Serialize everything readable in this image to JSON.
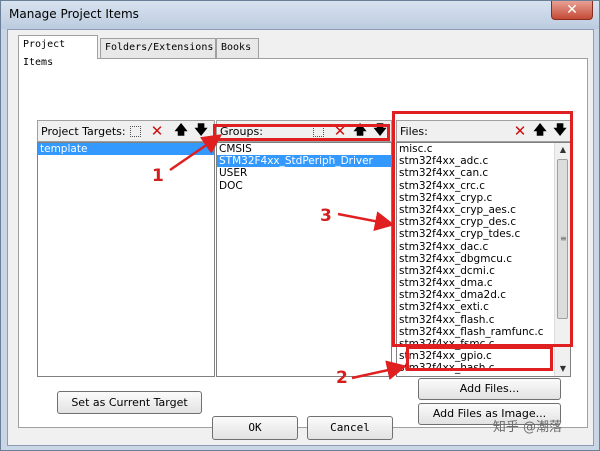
{
  "window": {
    "title": "Manage Project Items",
    "close_glyph": "✕"
  },
  "tabs": [
    {
      "label": "Project Items",
      "active": true
    },
    {
      "label": "Folders/Extensions",
      "active": false
    },
    {
      "label": "Books",
      "active": false
    }
  ],
  "project_targets": {
    "label": "Project Targets:",
    "items": [
      "template"
    ],
    "selected": "template"
  },
  "groups": {
    "label": "Groups:",
    "items": [
      "CMSIS",
      "STM32F4xx_StdPeriph_Driver",
      "USER",
      "DOC"
    ],
    "selected": "STM32F4xx_StdPeriph_Driver"
  },
  "files": {
    "label": "Files:",
    "items": [
      "misc.c",
      "stm32f4xx_adc.c",
      "stm32f4xx_can.c",
      "stm32f4xx_crc.c",
      "stm32f4xx_cryp.c",
      "stm32f4xx_cryp_aes.c",
      "stm32f4xx_cryp_des.c",
      "stm32f4xx_cryp_tdes.c",
      "stm32f4xx_dac.c",
      "stm32f4xx_dbgmcu.c",
      "stm32f4xx_dcmi.c",
      "stm32f4xx_dma.c",
      "stm32f4xx_dma2d.c",
      "stm32f4xx_exti.c",
      "stm32f4xx_flash.c",
      "stm32f4xx_flash_ramfunc.c",
      "stm32f4xx_fsmc.c",
      "stm32f4xx_gpio.c",
      "stm32f4xx_hash.c"
    ]
  },
  "buttons": {
    "set_current_target": "Set as Current Target",
    "add_files": "Add Files...",
    "add_files_as_image": "Add Files as Image...",
    "ok": "OK",
    "cancel": "Cancel"
  },
  "icons": {
    "new": "new-item-icon",
    "delete": "delete-icon",
    "move_up": "move-up-icon",
    "move_down": "move-down-icon",
    "delete_glyph": "✕",
    "up_glyph": "🡅",
    "down_glyph": "🡇"
  },
  "annotations": {
    "callout_1": "1",
    "callout_2": "2",
    "callout_3": "3",
    "color": "#e02020"
  },
  "watermark": "知乎 @潮落"
}
